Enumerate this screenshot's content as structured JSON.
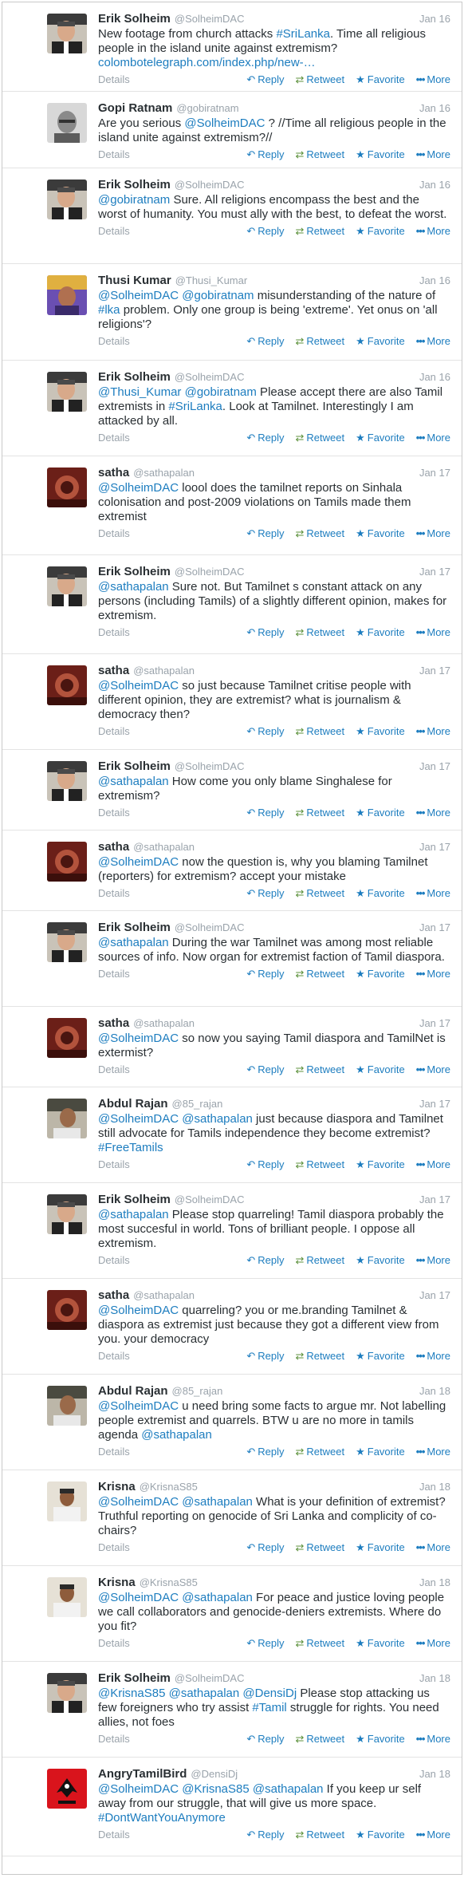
{
  "labels": {
    "details": "Details",
    "reply": "Reply",
    "retweet": "Retweet",
    "favorite": "Favorite",
    "more": "More"
  },
  "icons": {
    "reply": "reply-arrow",
    "retweet": "retweet-arrows",
    "favorite": "star",
    "more": "dots"
  },
  "tweets": [
    {
      "name": "Erik Solheim",
      "handle": "@SolheimDAC",
      "date": "Jan 16",
      "avatar": "erik",
      "h": 112,
      "parts": [
        {
          "t": "New footage from church attacks "
        },
        {
          "t": "#SriLanka",
          "m": true
        },
        {
          "t": ". Time all religious people in the island unite against extremism? "
        },
        {
          "t": "colombotelegraph.com/index.php/new-…",
          "m": true
        }
      ]
    },
    {
      "name": "Gopi Ratnam",
      "handle": "@gobiratnam",
      "date": "Jan 16",
      "avatar": "gopi",
      "h": 96,
      "parts": [
        {
          "t": "Are you serious "
        },
        {
          "t": "@SolheimDAC",
          "m": true
        },
        {
          "t": " ? //Time all religious people in the island unite against extremism?//"
        }
      ]
    },
    {
      "name": "Erik Solheim",
      "handle": "@SolheimDAC",
      "date": "Jan 16",
      "avatar": "erik",
      "h": 120,
      "parts": [
        {
          "t": "@gobiratnam",
          "m": true
        },
        {
          "t": "  Sure. All religions encompass the best and the worst of humanity. You must ally with the best, to defeat the worst."
        }
      ]
    },
    {
      "name": "Thusi Kumar",
      "handle": "@Thusi_Kumar",
      "date": "Jan 16",
      "avatar": "thusi",
      "h": 121,
      "parts": [
        {
          "t": "@SolheimDAC",
          "m": true
        },
        {
          "t": " "
        },
        {
          "t": "@gobiratnam",
          "m": true
        },
        {
          "t": " misunderstanding of the nature of "
        },
        {
          "t": "#lka",
          "m": true
        },
        {
          "t": " problem. Only one group is being 'extreme'. Yet onus on 'all religions'?"
        }
      ]
    },
    {
      "name": "Erik Solheim",
      "handle": "@SolheimDAC",
      "date": "Jan 16",
      "avatar": "erik",
      "h": 120,
      "parts": [
        {
          "t": "@Thusi_Kumar",
          "m": true
        },
        {
          "t": " "
        },
        {
          "t": "@gobiratnam",
          "m": true
        },
        {
          "t": " Please accept there are also Tamil extremists in "
        },
        {
          "t": "#SriLanka",
          "m": true
        },
        {
          "t": ". Look at Tamilnet. Interestingly I am attacked by all."
        }
      ]
    },
    {
      "name": "satha",
      "handle": "@sathapalan",
      "date": "Jan 17",
      "avatar": "satha",
      "h": 124,
      "parts": [
        {
          "t": "@SolheimDAC",
          "m": true
        },
        {
          "t": " loool does the tamilnet reports on Sinhala colonisation and post-2009 violations on Tamils made them extremist"
        }
      ]
    },
    {
      "name": "Erik Solheim",
      "handle": "@SolheimDAC",
      "date": "Jan 17",
      "avatar": "erik",
      "h": 124,
      "parts": [
        {
          "t": "@sathapalan",
          "m": true
        },
        {
          "t": " Sure not. But Tamilnet s constant attack on any persons (including Tamils) of a slightly different opinion, makes for extremism."
        }
      ]
    },
    {
      "name": "satha",
      "handle": "@sathapalan",
      "date": "Jan 17",
      "avatar": "satha",
      "h": 120,
      "parts": [
        {
          "t": "@SolheimDAC",
          "m": true
        },
        {
          "t": " so just because Tamilnet critise people with different opinion, they are extremist? what is journalism & democracy then?"
        }
      ]
    },
    {
      "name": "Erik Solheim",
      "handle": "@SolheimDAC",
      "date": "Jan 17",
      "avatar": "erik",
      "h": 101,
      "parts": [
        {
          "t": "@sathapalan",
          "m": true
        },
        {
          "t": " How come you only blame Singhalese for extremism?"
        }
      ]
    },
    {
      "name": "satha",
      "handle": "@sathapalan",
      "date": "Jan 17",
      "avatar": "satha",
      "h": 101,
      "parts": [
        {
          "t": "@SolheimDAC",
          "m": true
        },
        {
          "t": "  now the question is, why you blaming Tamilnet (reporters) for extremism? accept your mistake"
        }
      ]
    },
    {
      "name": "Erik Solheim",
      "handle": "@SolheimDAC",
      "date": "Jan 17",
      "avatar": "erik",
      "h": 120,
      "parts": [
        {
          "t": "@sathapalan",
          "m": true
        },
        {
          "t": "  During the war Tamilnet was among most reliable sources of info. Now organ for extremist faction of Tamil diaspora."
        }
      ]
    },
    {
      "name": "satha",
      "handle": "@sathapalan",
      "date": "Jan 17",
      "avatar": "satha",
      "h": 101,
      "parts": [
        {
          "t": "@SolheimDAC",
          "m": true
        },
        {
          "t": " so now you saying Tamil diaspora and TamilNet is extermist?"
        }
      ]
    },
    {
      "name": "Abdul Rajan",
      "handle": "@85_rajan",
      "date": "Jan 17",
      "avatar": "abdul",
      "h": 120,
      "parts": [
        {
          "t": "@SolheimDAC",
          "m": true
        },
        {
          "t": " "
        },
        {
          "t": "@sathapalan",
          "m": true
        },
        {
          "t": " just because diaspora and Tamilnet still advocate for Tamils independence they become extremist? "
        },
        {
          "t": "#FreeTamils",
          "m": true
        }
      ]
    },
    {
      "name": "Erik Solheim",
      "handle": "@SolheimDAC",
      "date": "Jan 17",
      "avatar": "erik",
      "h": 120,
      "parts": [
        {
          "t": "@sathapalan",
          "m": true
        },
        {
          "t": " Please stop quarreling! Tamil diaspora probably the most succesful in world. Tons of brilliant people. I oppose all extremism."
        }
      ]
    },
    {
      "name": "satha",
      "handle": "@sathapalan",
      "date": "Jan 17",
      "avatar": "satha",
      "h": 120,
      "parts": [
        {
          "t": "@SolheimDAC",
          "m": true
        },
        {
          "t": " quarreling? you or me.branding Tamilnet & diaspora as extremist just because they got a different view from you. your democracy"
        }
      ]
    },
    {
      "name": "Abdul Rajan",
      "handle": "@85_rajan",
      "date": "Jan 18",
      "avatar": "abdul",
      "h": 120,
      "parts": [
        {
          "t": "@SolheimDAC",
          "m": true
        },
        {
          "t": " u need bring some facts to argue mr. Not labelling people extremist and quarrels. BTW u are no more in tamils agenda "
        },
        {
          "t": "@sathapalan",
          "m": true
        }
      ]
    },
    {
      "name": "Krisna",
      "handle": "@KrisnaS85",
      "date": "Jan 18",
      "avatar": "krisna",
      "h": 120,
      "parts": [
        {
          "t": "@SolheimDAC",
          "m": true
        },
        {
          "t": " "
        },
        {
          "t": "@sathapalan",
          "m": true
        },
        {
          "t": " What is your definition of extremist? Truthful reporting on genocide of Sri Lanka and complicity of co-chairs?"
        }
      ]
    },
    {
      "name": "Krisna",
      "handle": "@KrisnaS85",
      "date": "Jan 18",
      "avatar": "krisna",
      "h": 120,
      "parts": [
        {
          "t": "@SolheimDAC",
          "m": true
        },
        {
          "t": " "
        },
        {
          "t": "@sathapalan",
          "m": true
        },
        {
          "t": " For peace and justice loving people we call collaborators and genocide-deniers extremists. Where do you fit?"
        }
      ]
    },
    {
      "name": "Erik Solheim",
      "handle": "@SolheimDAC",
      "date": "Jan 18",
      "avatar": "erik",
      "h": 120,
      "parts": [
        {
          "t": "@KrisnaS85",
          "m": true
        },
        {
          "t": " "
        },
        {
          "t": "@sathapalan",
          "m": true
        },
        {
          "t": " "
        },
        {
          "t": "@DensiDj",
          "m": true
        },
        {
          "t": " Please stop attacking us few foreigners who try assist "
        },
        {
          "t": "#Tamil",
          "m": true
        },
        {
          "t": " struggle for rights. You need allies, not foes"
        }
      ]
    },
    {
      "name": "AngryTamilBird",
      "handle": "@DensiDj",
      "date": "Jan 18",
      "avatar": "bird",
      "h": 124,
      "parts": [
        {
          "t": "@SolheimDAC",
          "m": true
        },
        {
          "t": " "
        },
        {
          "t": "@KrisnaS85",
          "m": true
        },
        {
          "t": " "
        },
        {
          "t": "@sathapalan",
          "m": true
        },
        {
          "t": "  If you keep ur self away from our struggle, that will give us more space. "
        },
        {
          "t": "#DontWantYouAnymore",
          "m": true
        }
      ]
    }
  ]
}
